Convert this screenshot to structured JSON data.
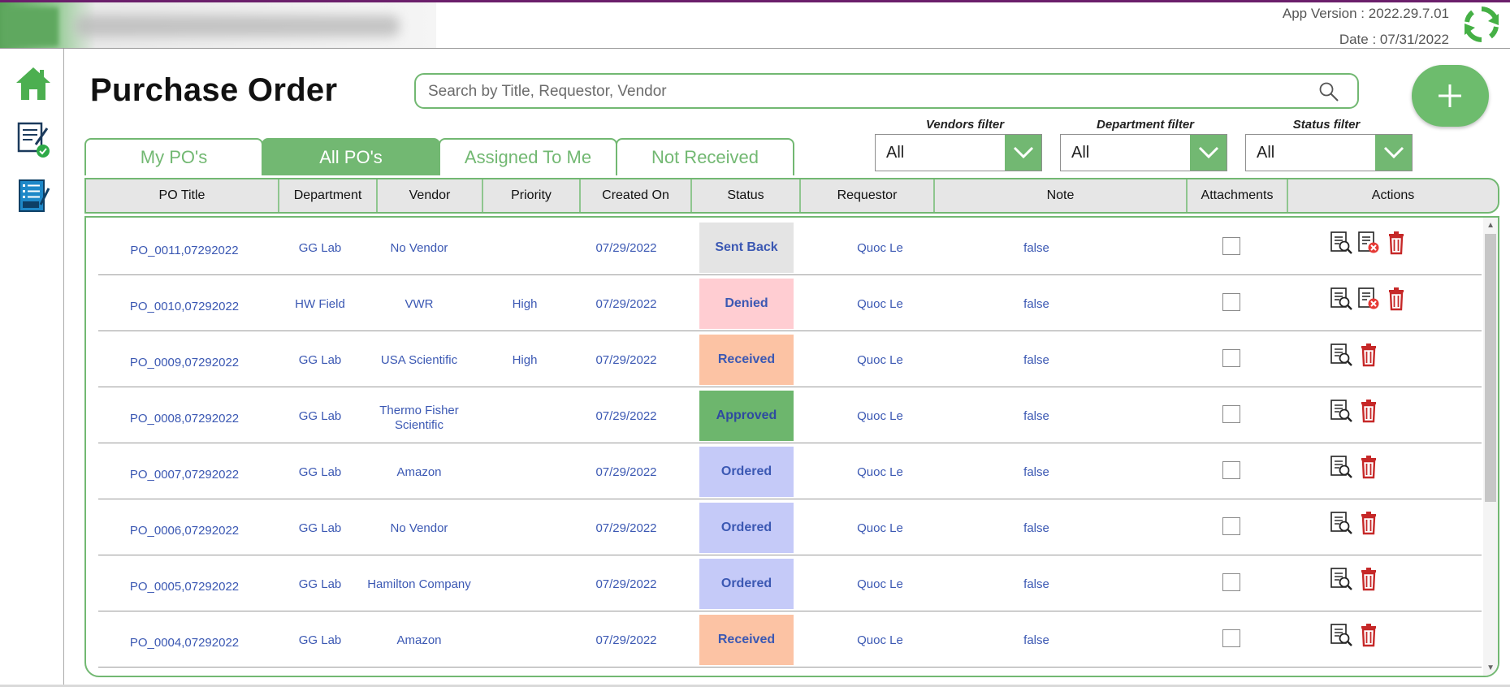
{
  "app": {
    "version": "App Version : 2022.29.7.01",
    "date": "Date : 07/31/2022"
  },
  "colors": {
    "accent": "#72b872",
    "link_text": "#3b58b3",
    "status_sent_back": "#e4e4e4",
    "status_denied": "#ffcdd2",
    "status_received": "#fcc3a4",
    "status_approved": "#6db66d",
    "status_ordered": "#c5caf8",
    "delete_red": "#c62828"
  },
  "sidebar": {
    "items": [
      {
        "icon": "home-icon"
      },
      {
        "icon": "approval-doc-icon"
      },
      {
        "icon": "purchase-list-icon"
      }
    ]
  },
  "page": {
    "title": "Purchase Order"
  },
  "search": {
    "placeholder": "Search by Title, Requestor, Vendor"
  },
  "tabs": [
    {
      "label": "My PO's",
      "active": false
    },
    {
      "label": "All PO's",
      "active": true
    },
    {
      "label": "Assigned To Me",
      "active": false
    },
    {
      "label": "Not Received",
      "active": false
    }
  ],
  "filters": [
    {
      "label": "Vendors filter",
      "value": "All"
    },
    {
      "label": "Department filter",
      "value": "All"
    },
    {
      "label": "Status filter",
      "value": "All"
    }
  ],
  "table": {
    "columns": [
      "PO Title",
      "Department",
      "Vendor",
      "Priority",
      "Created On",
      "Status",
      "Requestor",
      "Note",
      "Attachments",
      "Actions"
    ],
    "rows": [
      {
        "po": "PO_0011,07292022",
        "dep": "GG Lab",
        "vendor": "No Vendor",
        "priority": "",
        "created": "07/29/2022",
        "status": "Sent Back",
        "requestor": "Quoc Le",
        "note": "false",
        "actions": [
          "view-icon",
          "reject-doc-icon",
          "delete-icon"
        ]
      },
      {
        "po": "PO_0010,07292022",
        "dep": "HW Field",
        "vendor": "VWR",
        "priority": "High",
        "created": "07/29/2022",
        "status": "Denied",
        "requestor": "Quoc Le",
        "note": "false",
        "actions": [
          "view-icon",
          "reject-doc-icon",
          "delete-icon"
        ]
      },
      {
        "po": "PO_0009,07292022",
        "dep": "GG Lab",
        "vendor": "USA Scientific",
        "priority": "High",
        "created": "07/29/2022",
        "status": "Received",
        "requestor": "Quoc Le",
        "note": "false",
        "actions": [
          "view-icon",
          "delete-icon"
        ]
      },
      {
        "po": "PO_0008,07292022",
        "dep": "GG Lab",
        "vendor": "Thermo Fisher Scientific",
        "priority": "",
        "created": "07/29/2022",
        "status": "Approved",
        "requestor": "Quoc Le",
        "note": "false",
        "actions": [
          "view-icon",
          "delete-icon"
        ]
      },
      {
        "po": "PO_0007,07292022",
        "dep": "GG Lab",
        "vendor": "Amazon",
        "priority": "",
        "created": "07/29/2022",
        "status": "Ordered",
        "requestor": "Quoc Le",
        "note": "false",
        "actions": [
          "view-icon",
          "delete-icon"
        ]
      },
      {
        "po": "PO_0006,07292022",
        "dep": "GG Lab",
        "vendor": "No Vendor",
        "priority": "",
        "created": "07/29/2022",
        "status": "Ordered",
        "requestor": "Quoc Le",
        "note": "false",
        "actions": [
          "view-icon",
          "delete-icon"
        ]
      },
      {
        "po": "PO_0005,07292022",
        "dep": "GG Lab",
        "vendor": "Hamilton Company",
        "priority": "",
        "created": "07/29/2022",
        "status": "Ordered",
        "requestor": "Quoc Le",
        "note": "false",
        "actions": [
          "view-icon",
          "delete-icon"
        ]
      },
      {
        "po": "PO_0004,07292022",
        "dep": "GG Lab",
        "vendor": "Amazon",
        "priority": "",
        "created": "07/29/2022",
        "status": "Received",
        "requestor": "Quoc Le",
        "note": "false",
        "actions": [
          "view-icon",
          "delete-icon"
        ]
      }
    ]
  }
}
